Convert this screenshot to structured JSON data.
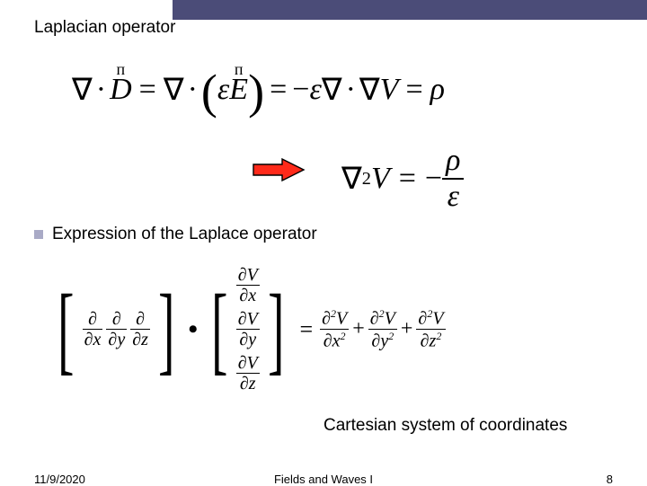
{
  "slide": {
    "title": "Laplacian operator",
    "bullet_text": "Expression of the Laplace operator",
    "subcaption": "Cartesian system of coordinates"
  },
  "equations": {
    "eq1": {
      "nabla": "∇",
      "dot": "·",
      "D": "D",
      "eq": "=",
      "eps": "ε",
      "E": "E",
      "minus": "−",
      "V": "V",
      "rho": "ρ",
      "vec_glyph": "ᴨ"
    },
    "eq2": {
      "nabla": "∇",
      "sup2": "2",
      "V": "V",
      "eq": "=",
      "minus": "−",
      "rho": "ρ",
      "eps": "ε"
    },
    "eq3": {
      "partial": "∂",
      "V": "V",
      "x": "x",
      "y": "y",
      "z": "z",
      "eq": "=",
      "plus": "+",
      "sup2": "2"
    }
  },
  "footer": {
    "date": "11/9/2020",
    "center": "Fields and Waves I",
    "page": "8"
  },
  "colors": {
    "titlebar": "#4b4c78",
    "bullet": "#a9aac6",
    "arrow_fill": "#ff2a1a",
    "arrow_stroke": "#000000"
  }
}
